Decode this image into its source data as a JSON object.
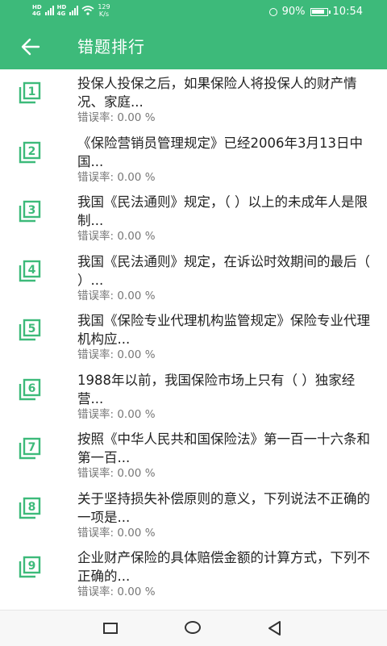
{
  "status_bar": {
    "hd1": "HD",
    "hd2": "HD",
    "net1": "4G",
    "net2": "4G",
    "speed_value": "129",
    "speed_unit": "K/s",
    "battery_percent": "90%",
    "time": "10:54"
  },
  "header": {
    "title": "错题排行"
  },
  "colors": {
    "accent": "#3dba7a",
    "question_text": "#222222",
    "meta_text": "#777777"
  },
  "questions": [
    {
      "num": "1",
      "text": "投保人投保之后，如果保险人将投保人的财产情况、家庭...",
      "error": "错误率: 0.00 %"
    },
    {
      "num": "2",
      "text": "《保险营销员管理规定》已经2006年3月13日中国...",
      "error": "错误率: 0.00 %"
    },
    {
      "num": "3",
      "text": "我国《民法通则》规定，（ ）以上的未成年人是限制...",
      "error": "错误率: 0.00 %"
    },
    {
      "num": "4",
      "text": "我国《民法通则》规定，在诉讼时效期间的最后（ ）...",
      "error": "错误率: 0.00 %"
    },
    {
      "num": "5",
      "text": "我国《保险专业代理机构监管规定》保险专业代理机构应...",
      "error": "错误率: 0.00 %"
    },
    {
      "num": "6",
      "text": "1988年以前，我国保险市场上只有（ ）独家经营...",
      "error": "错误率: 0.00 %"
    },
    {
      "num": "7",
      "text": "按照《中华人民共和国保险法》第一百一十六条和第一百...",
      "error": "错误率: 0.00 %"
    },
    {
      "num": "8",
      "text": "关于坚持损失补偿原则的意义，下列说法不正确的一项是...",
      "error": "错误率: 0.00 %"
    },
    {
      "num": "9",
      "text": "企业财产保险的具体赔偿金额的计算方式，下列不正确的...",
      "error": "错误率: 0.00 %"
    }
  ],
  "navigation": {
    "recents_icon": "square-icon",
    "home_icon": "circle-icon",
    "back_icon": "triangle-back-icon"
  }
}
